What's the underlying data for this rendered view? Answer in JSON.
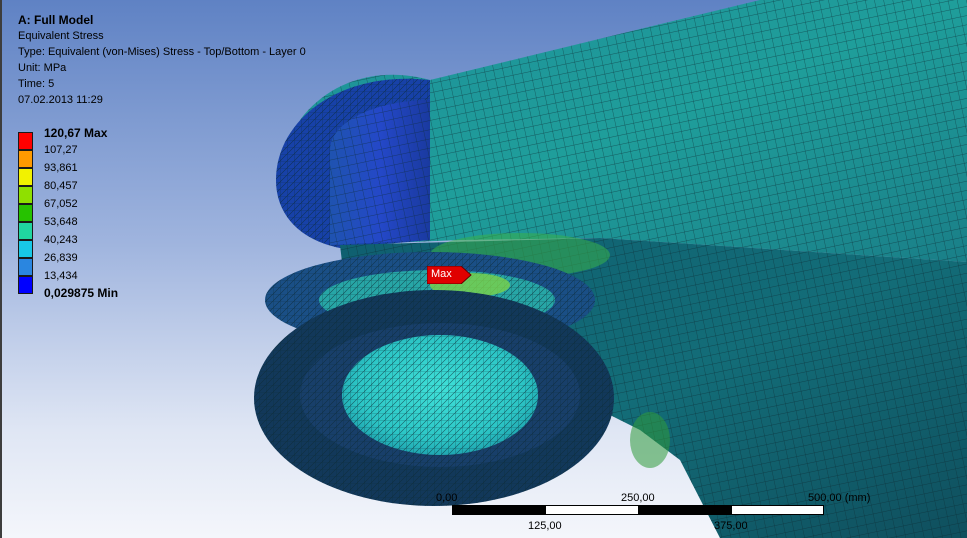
{
  "title": "A: Full Model",
  "info_lines": [
    "Equivalent Stress",
    "Type: Equivalent (von-Mises) Stress - Top/Bottom - Layer 0",
    "Unit: MPa",
    "Time: 5",
    "07.02.2013 11:29"
  ],
  "legend": {
    "max_label": "120,67 Max",
    "min_label": "0,029875 Min",
    "values": [
      "107,27",
      "93,861",
      "80,457",
      "67,052",
      "53,648",
      "40,243",
      "26,839",
      "13,434"
    ],
    "colors": [
      "#ff0000",
      "#ff9a00",
      "#f2f200",
      "#8fe000",
      "#26c200",
      "#20d6a0",
      "#18c8e6",
      "#2a86e0",
      "#0000ff"
    ]
  },
  "probe": {
    "label": "Max",
    "color": "#e00000"
  },
  "scale_bar": {
    "top_labels": [
      "0,00",
      "250,00",
      "500,00 (mm)"
    ],
    "bottom_labels": [
      "125,00",
      "375,00"
    ]
  }
}
